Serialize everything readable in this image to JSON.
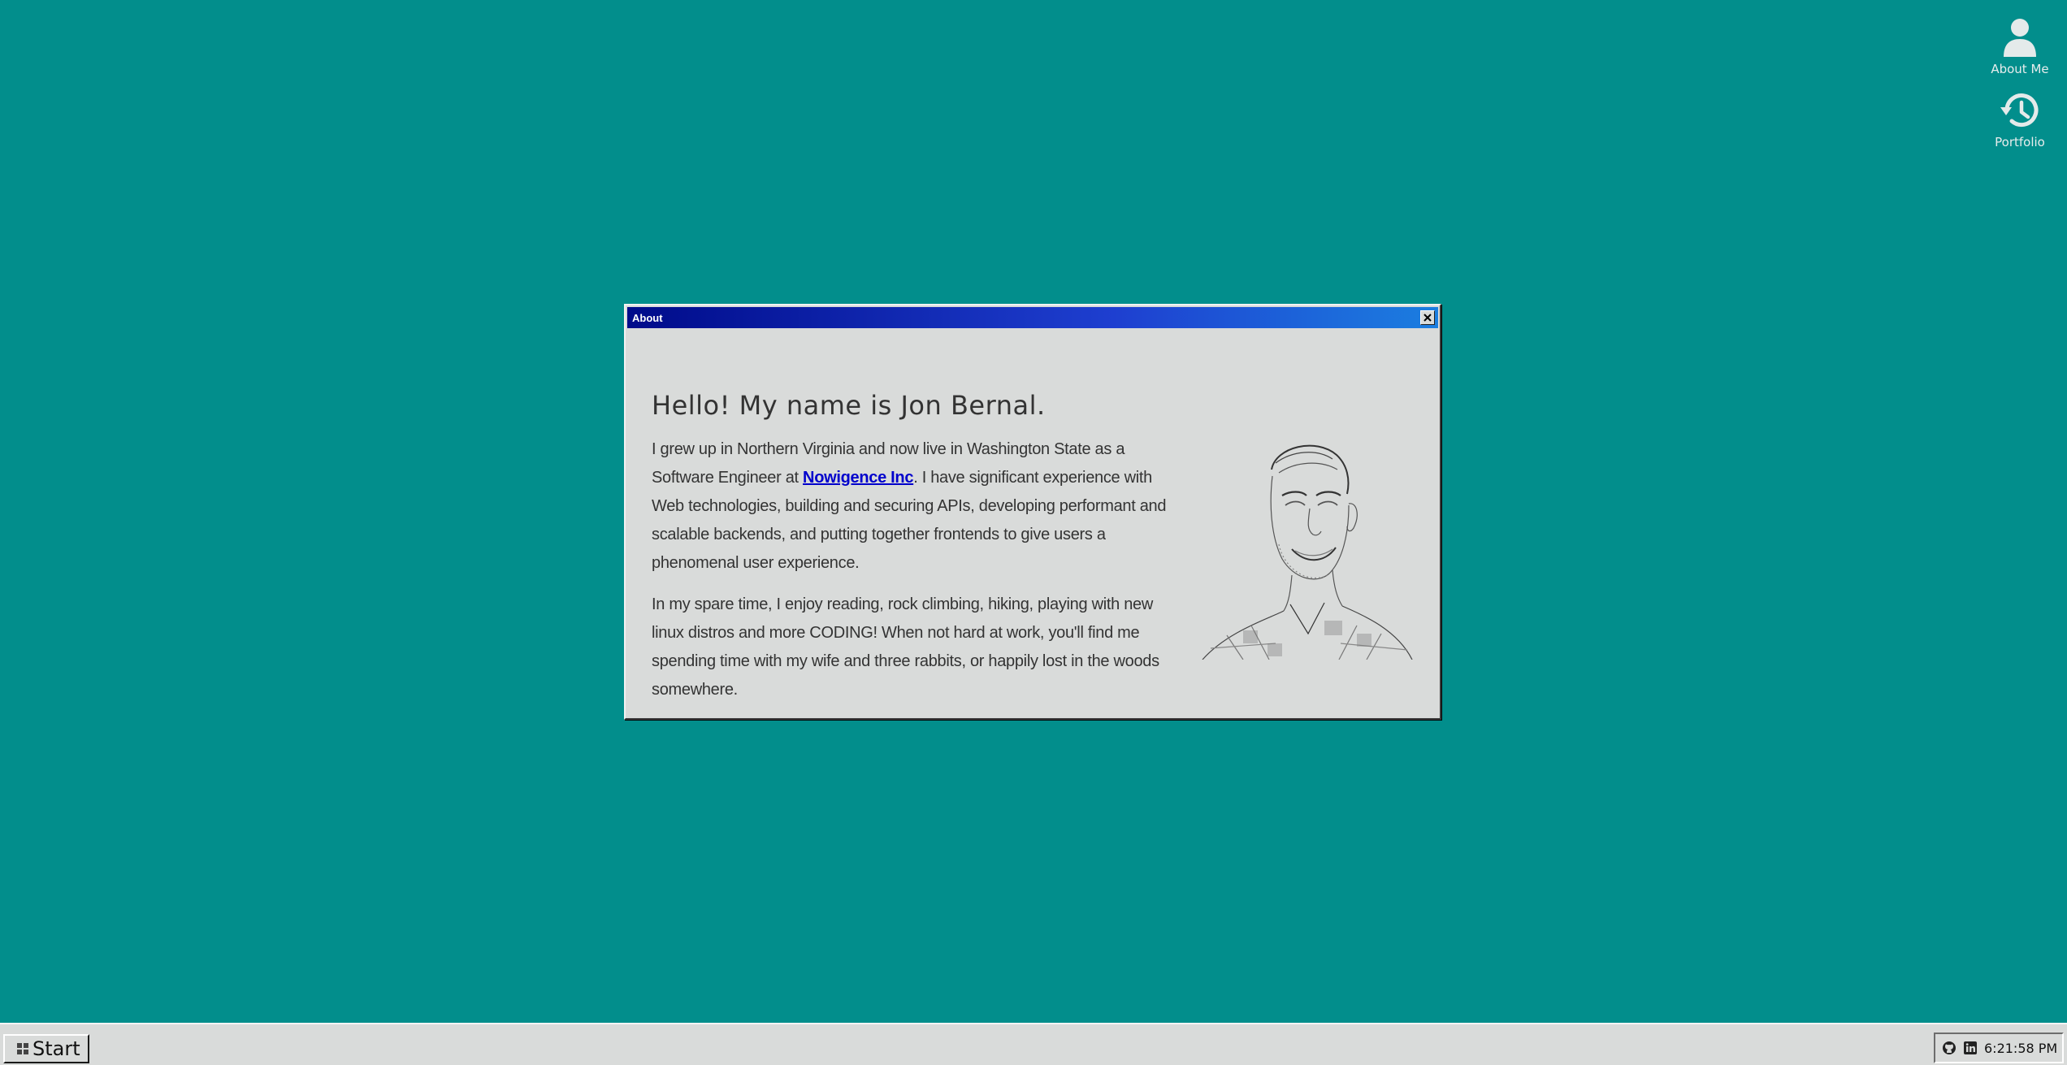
{
  "desktop": {
    "icons": [
      {
        "label": "About Me",
        "icon": "user-icon"
      },
      {
        "label": "Portfolio",
        "icon": "history-icon"
      }
    ]
  },
  "window": {
    "title": "About",
    "heading": "Hello! My name is Jon Bernal.",
    "para1_before": "I grew up in Northern Virginia and now live in Washington State as a Software Engineer at ",
    "para1_link": "Nowigence Inc",
    "para1_after": ". I have significant experience with Web technologies, building and securing APIs, developing performant and scalable backends, and putting together frontends to give users a phenomenal user experience.",
    "para2": "In my spare time, I enjoy reading, rock climbing, hiking, playing with new linux distros and more CODING! When not hard at work, you'll find me spending time with my wife and three rabbits, or happily lost in the woods somewhere."
  },
  "taskbar": {
    "start_label": "Start",
    "tray_icons": [
      "github-icon",
      "linkedin-icon"
    ],
    "clock": "6:21:58 PM"
  },
  "colors": {
    "desktop": "#028e8c",
    "window_bg": "#d9dbda",
    "title_start": "#000b8a",
    "title_end": "#1b7ee0",
    "link": "#0000cc"
  }
}
